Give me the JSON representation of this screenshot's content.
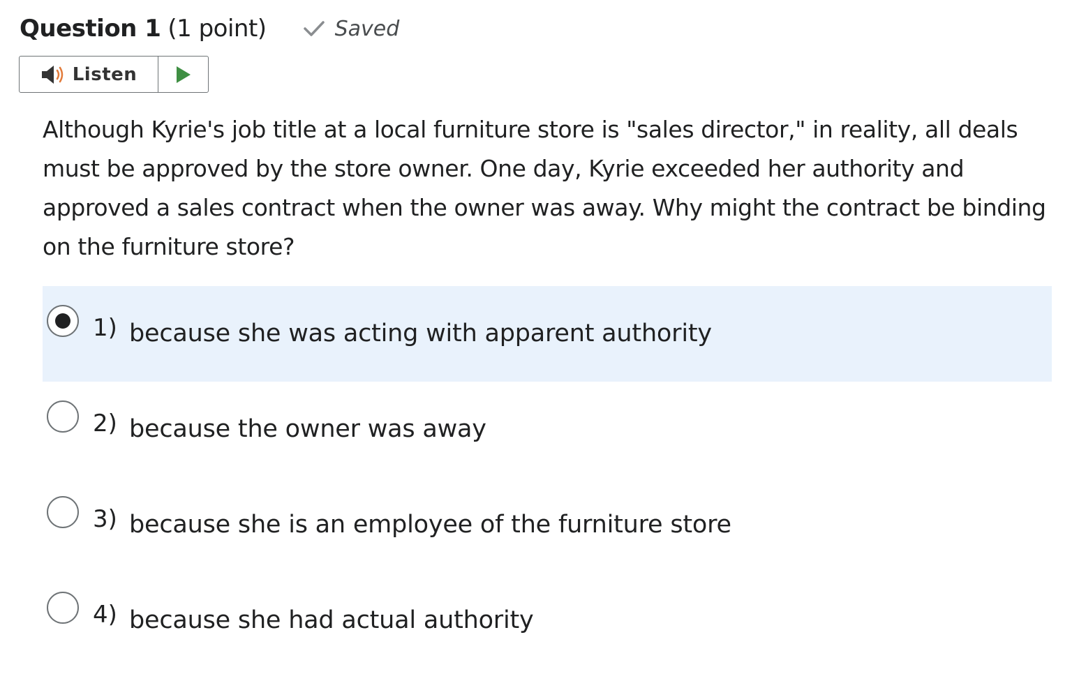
{
  "question": {
    "title": "Question 1",
    "points": "(1 point)",
    "status": "Saved",
    "text": "Although Kyrie's job title at a local furniture store is \"sales director,\" in reality, all deals must be approved by the store owner. One day, Kyrie exceeded her authority and approved a sales contract when the owner was away. Why might the contract be binding on the furniture store?"
  },
  "listen": {
    "label": "Listen",
    "icons": [
      "speaker-icon",
      "play-icon"
    ],
    "speaker_color": "#e27b3a",
    "play_color": "#3f8f43"
  },
  "options": [
    {
      "number": "1)",
      "text": "because she was acting with apparent authority",
      "selected": true
    },
    {
      "number": "2)",
      "text": "because the owner was away",
      "selected": false
    },
    {
      "number": "3)",
      "text": "because she is an employee of the furniture store",
      "selected": false
    },
    {
      "number": "4)",
      "text": "because she had actual authority",
      "selected": false
    }
  ],
  "colors": {
    "selected_background": "#e9f2fc",
    "text": "#202122",
    "border": "#6e7376"
  }
}
